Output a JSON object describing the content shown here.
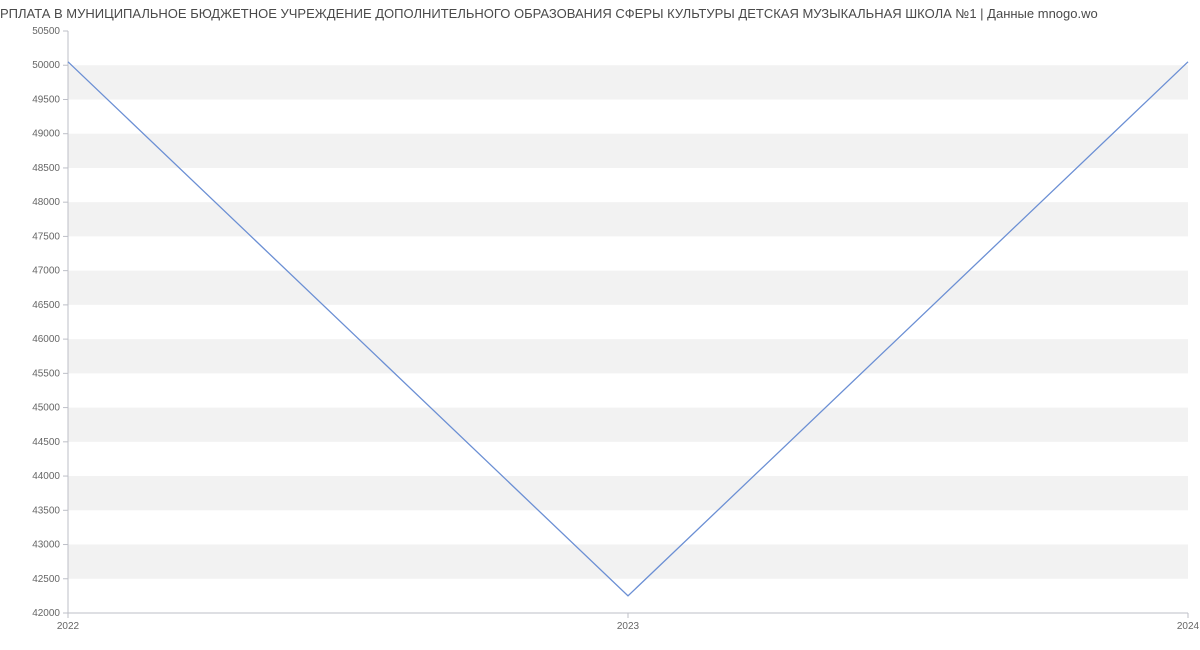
{
  "title": "РПЛАТА В МУНИЦИПАЛЬНОЕ БЮДЖЕТНОЕ УЧРЕЖДЕНИЕ ДОПОЛНИТЕЛЬНОГО ОБРАЗОВАНИЯ СФЕРЫ КУЛЬТУРЫ ДЕТСКАЯ МУЗЫКАЛЬНАЯ ШКОЛА №1 | Данные mnogo.wo",
  "chart_data": {
    "type": "line",
    "x": [
      2022,
      2023,
      2024
    ],
    "values": [
      50050,
      42250,
      50050
    ],
    "title": "",
    "xlabel": "",
    "ylabel": "",
    "ylim": [
      42000,
      50500
    ],
    "yticks": [
      42000,
      42500,
      43000,
      43500,
      44000,
      44500,
      45000,
      45500,
      46000,
      46500,
      47000,
      47500,
      48000,
      48500,
      49000,
      49500,
      50000,
      50500
    ],
    "xticks": [
      2022,
      2023,
      2024
    ]
  }
}
